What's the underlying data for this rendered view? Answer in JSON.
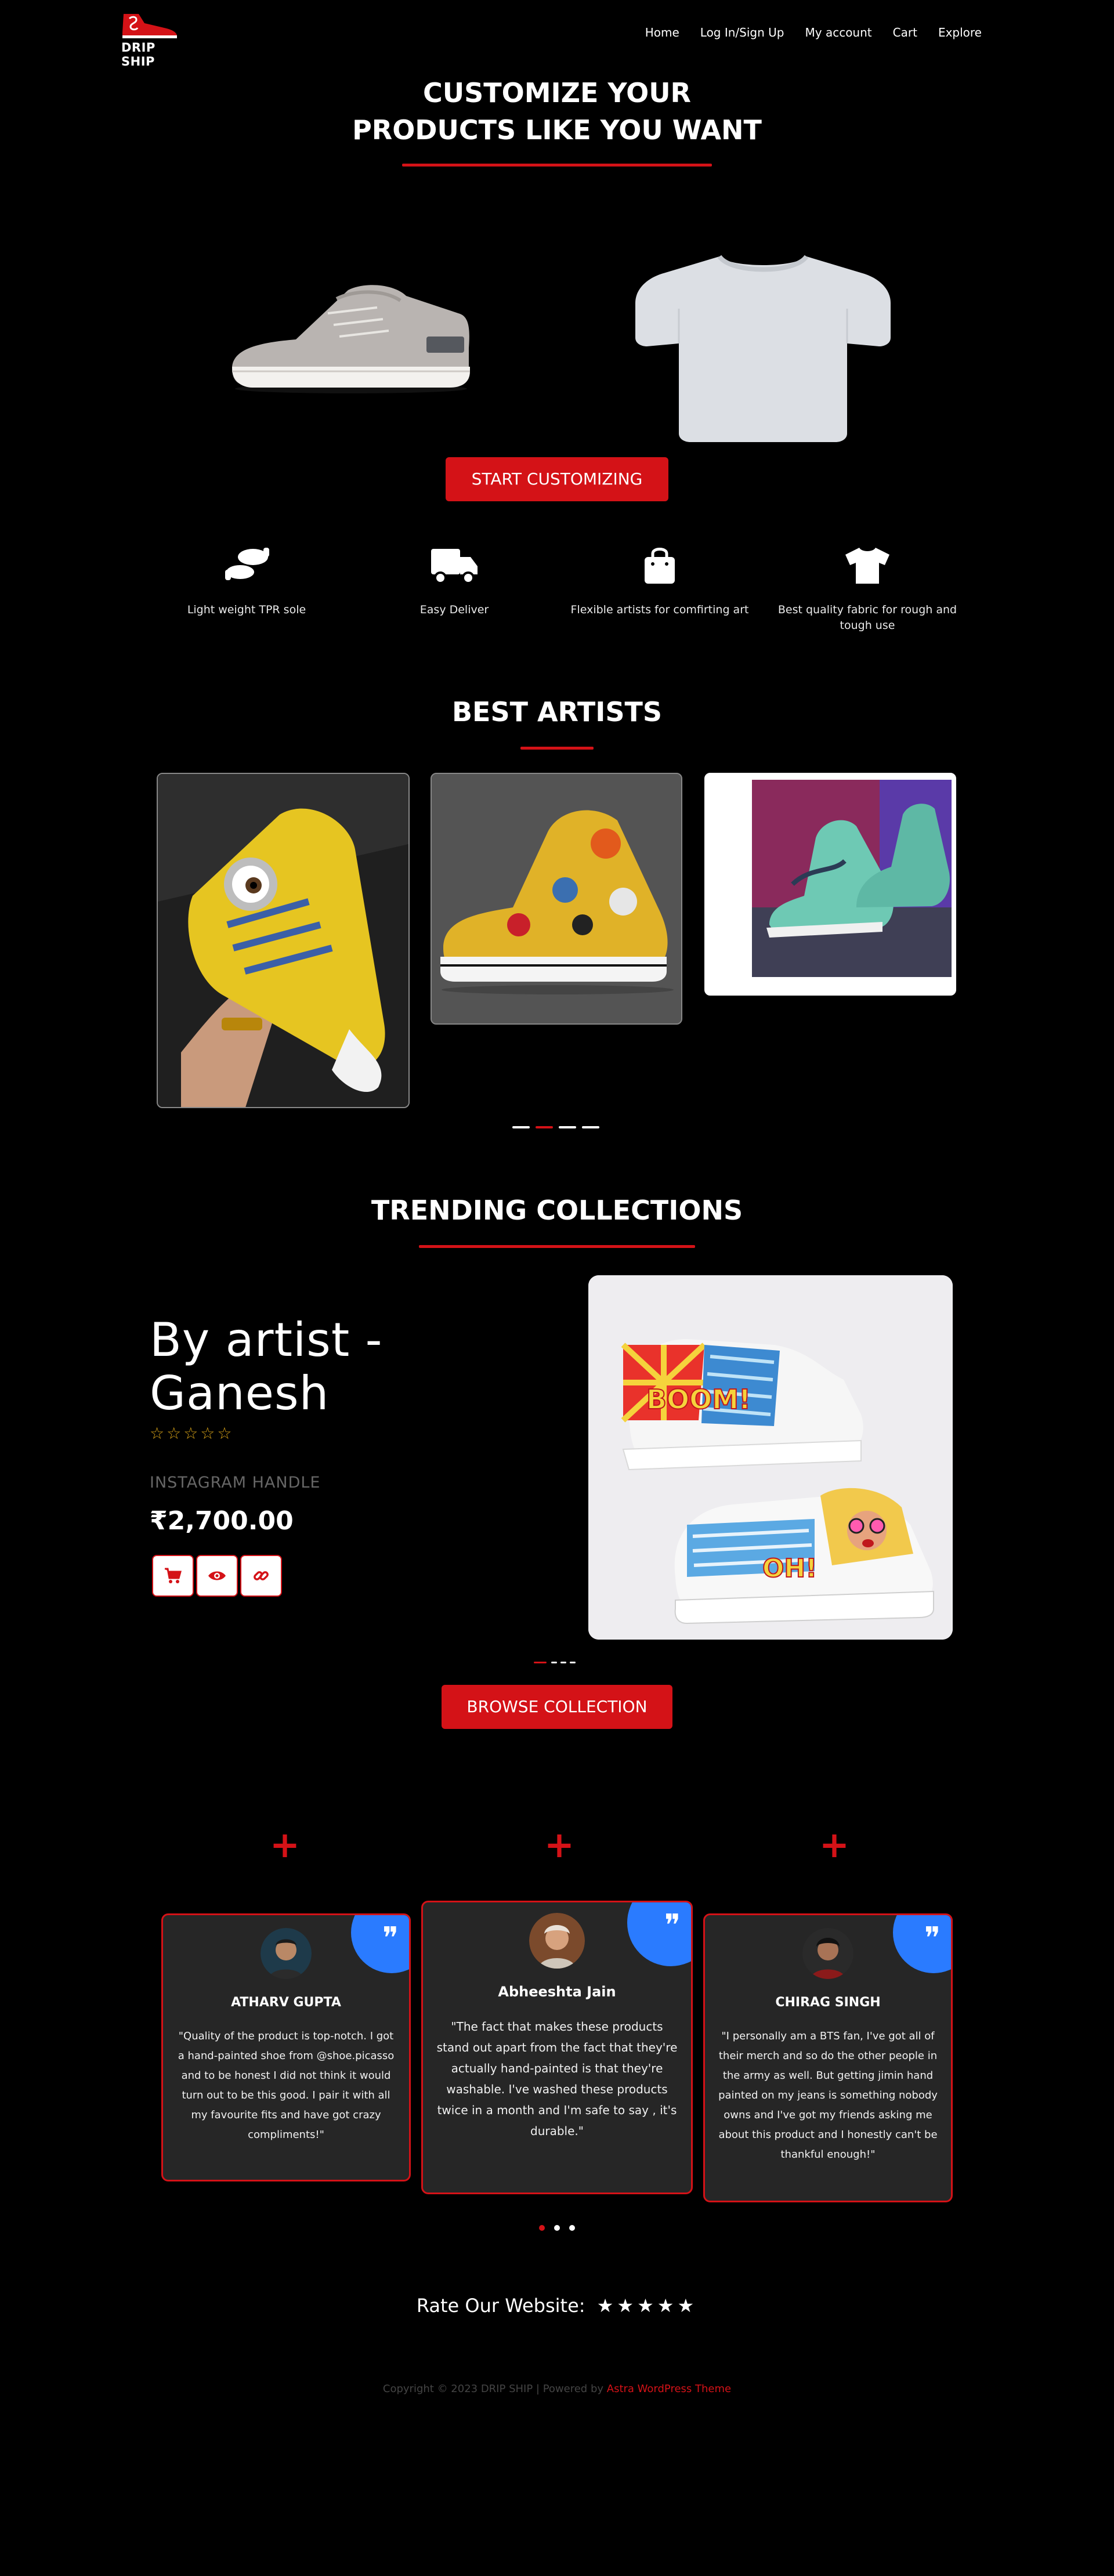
{
  "nav": {
    "logo_text": "DRIP SHIP",
    "links": [
      "Home",
      "Log In/Sign Up",
      "My account",
      "Cart",
      "Explore"
    ]
  },
  "hero": {
    "title_line1": "CUSTOMIZE YOUR",
    "title_line2": "PRODUCTS LIKE YOU WANT",
    "cta": "START CUSTOMIZING"
  },
  "features": [
    {
      "icon": "footprints-icon",
      "label": "Light weight TPR sole"
    },
    {
      "icon": "truck-icon",
      "label": "Easy Deliver"
    },
    {
      "icon": "shopping-bag-icon",
      "label": "Flexible artists for comfirting art"
    },
    {
      "icon": "tshirt-icon",
      "label": "Best quality fabric for rough and tough use"
    }
  ],
  "artists": {
    "title": "BEST ARTISTS"
  },
  "trending": {
    "title": "TRENDING COLLECTIONS",
    "artist_line1": "By artist -",
    "artist_line2": "Ganesh",
    "stars": "☆☆☆☆☆",
    "handle": "INSTAGRAM HANDLE",
    "price": "₹2,700.00",
    "cta": "BROWSE COLLECTION",
    "image_text_top": "BOOM!",
    "image_text_bottom": "OH!"
  },
  "testimonials": [
    {
      "name": "ATHARV GUPTA",
      "text": "\"Quality of the product is top-notch. I got a hand-painted shoe from @shoe.picasso and to be honest I did not think it would turn out to be this good. I pair it with all my favourite fits and have got crazy compliments!\""
    },
    {
      "name": "Abheeshta Jain",
      "text": "\"The fact that makes these products stand out apart from the fact that they're actually hand-painted is that they're washable. I've washed these products twice in a month and I'm safe to say , it's durable.\""
    },
    {
      "name": "CHIRAG SINGH",
      "text": "\"I personally am a BTS fan, I've got all of their merch and so do the other people in the army as well. But getting jimin hand painted on my jeans is something nobody owns and I've got my friends asking me about this product and I honestly can't be thankful enough!\""
    }
  ],
  "rating": {
    "label": "Rate Our Website:",
    "stars": "★★★★★"
  },
  "footer": {
    "text": "Copyright © 2023 DRIP SHIP | Powered by ",
    "link": "Astra WordPress Theme"
  },
  "colors": {
    "accent": "#d41217",
    "background": "#000000",
    "card": "#262626",
    "quote_blue": "#2a7bff"
  }
}
